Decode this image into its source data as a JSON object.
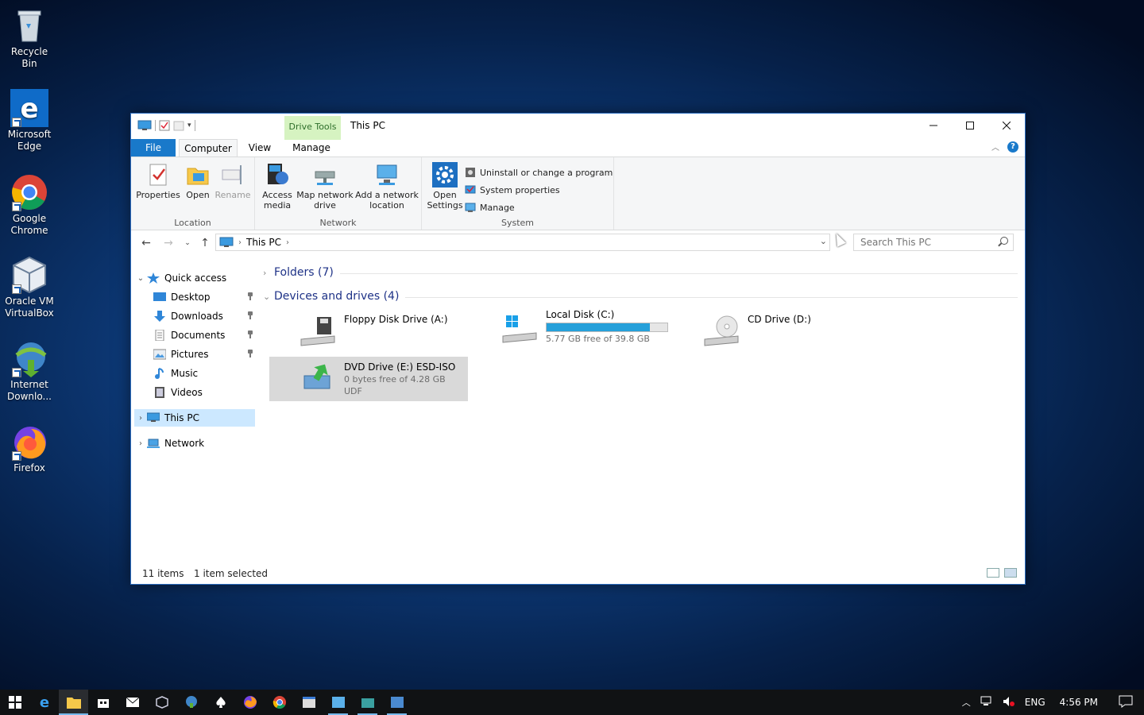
{
  "desktop": {
    "icons": [
      {
        "label": "Recycle Bin"
      },
      {
        "label": "Microsoft Edge"
      },
      {
        "label": "Google Chrome"
      },
      {
        "label": "Oracle VM VirtualBox"
      },
      {
        "label": "Internet Downlo..."
      },
      {
        "label": "Firefox"
      }
    ]
  },
  "window": {
    "title": "This PC",
    "contextual_tab": "Drive Tools",
    "tabs": {
      "file": "File",
      "computer": "Computer",
      "view": "View",
      "manage": "Manage"
    },
    "help": "?"
  },
  "ribbon": {
    "location": {
      "label": "Location",
      "properties": "Properties",
      "open": "Open",
      "rename": "Rename"
    },
    "network": {
      "label": "Network",
      "access_media": "Access media",
      "map_drive": "Map network drive",
      "add_location": "Add a network location"
    },
    "system": {
      "label": "System",
      "open_settings": "Open Settings",
      "uninstall": "Uninstall or change a program",
      "system_properties": "System properties",
      "manage": "Manage"
    }
  },
  "address": {
    "crumb": "This PC",
    "search_placeholder": "Search This PC"
  },
  "navpane": {
    "quick_access": "Quick access",
    "items": [
      "Desktop",
      "Downloads",
      "Documents",
      "Pictures",
      "Music",
      "Videos"
    ],
    "this_pc": "This PC",
    "network": "Network"
  },
  "content": {
    "folders_header": "Folders (7)",
    "devices_header": "Devices and drives (4)",
    "drives": [
      {
        "name": "Floppy Disk Drive (A:)",
        "sub": "",
        "fs": ""
      },
      {
        "name": "Local Disk (C:)",
        "sub": "5.77 GB free of 39.8 GB",
        "used_fraction": 0.855
      },
      {
        "name": "CD Drive (D:)",
        "sub": ""
      },
      {
        "name": "DVD Drive (E:) ESD-ISO",
        "sub": "0 bytes free of 4.28 GB",
        "fs": "UDF"
      }
    ]
  },
  "status": {
    "items": "11 items",
    "selected": "1 item selected"
  },
  "taskbar": {
    "lang": "ENG",
    "time": "4:56 PM"
  },
  "colors": {
    "accent": "#1979ca",
    "bar_fill": "#26a0da",
    "selection": "#cce8ff"
  }
}
